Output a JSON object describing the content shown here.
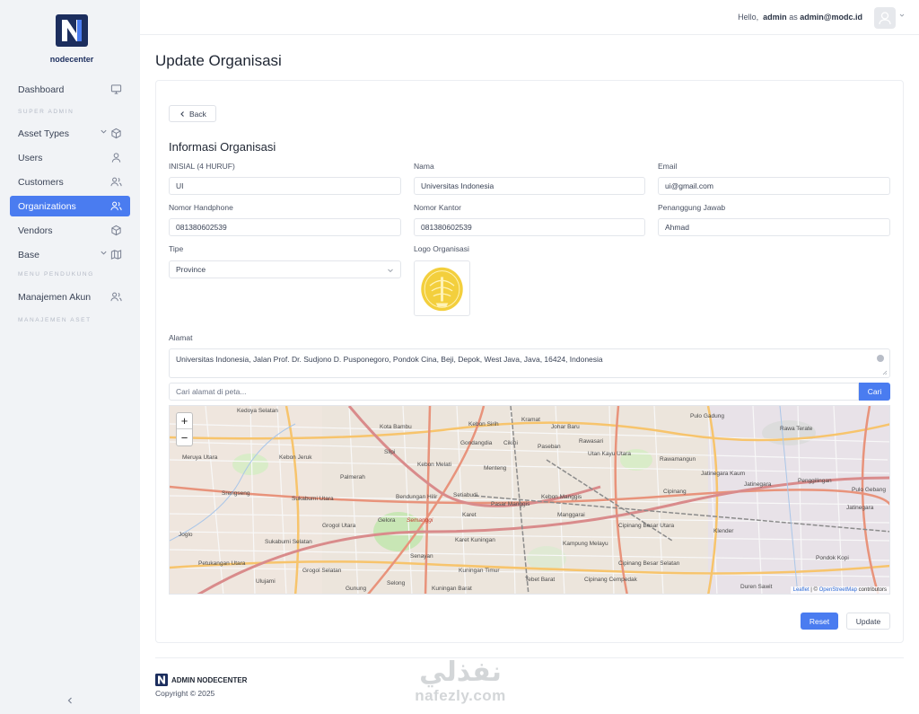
{
  "brand": {
    "name": "nodecenter",
    "footer_name": "ADMIN NODECENTER",
    "copyright": "Copyright © 2025"
  },
  "sidebar": {
    "items": [
      {
        "label": "Dashboard",
        "icon": "monitor-icon"
      },
      {
        "label": "Asset Types",
        "icon": "box-icon"
      },
      {
        "label": "Users",
        "icon": "user-icon"
      },
      {
        "label": "Customers",
        "icon": "users-icon"
      },
      {
        "label": "Organizations",
        "icon": "users-icon",
        "active": true
      },
      {
        "label": "Vendors",
        "icon": "box-icon"
      },
      {
        "label": "Base",
        "icon": "map-icon"
      },
      {
        "label": "Manajemen Akun",
        "icon": "users-icon"
      }
    ],
    "sections": [
      "SUPER ADMIN",
      "MENU PENDUKUNG",
      "MANAJEMEN ASET DINAMIS"
    ]
  },
  "header": {
    "hello": "Hello,",
    "user": "admin",
    "as": "as",
    "email": "admin@modc.id"
  },
  "page": {
    "title": "Update Organisasi",
    "back": "Back",
    "section": "Informasi Organisasi"
  },
  "form": {
    "inisial": {
      "label": "INISIAL (4 HURUF)",
      "value": "UI"
    },
    "nama": {
      "label": "Nama",
      "value": "Universitas Indonesia"
    },
    "email": {
      "label": "Email",
      "value": "ui@gmail.com"
    },
    "hp": {
      "label": "Nomor Handphone",
      "value": "081380602539"
    },
    "kantor": {
      "label": "Nomor Kantor",
      "value": "081380602539"
    },
    "pj": {
      "label": "Penanggung Jawab",
      "value": "Ahmad"
    },
    "tipe": {
      "label": "Tipe",
      "value": "Province"
    },
    "logo": {
      "label": "Logo Organisasi"
    },
    "alamat": {
      "label": "Alamat",
      "value": "Universitas Indonesia, Jalan Prof. Dr. Sudjono D. Pusponegoro, Pondok Cina, Beji, Depok, West Java, Java, 16424, Indonesia"
    }
  },
  "map": {
    "search_placeholder": "Cari alamat di peta...",
    "search_button": "Cari",
    "zoom_in": "+",
    "zoom_out": "−",
    "attr_leaflet": "Leaflet",
    "attr_sep": " | © ",
    "attr_osm": "OpenStreetMap",
    "attr_contrib": " contributors",
    "labels": [
      "Kedoya Selatan",
      "Kota Bambu",
      "Kebon Sirih",
      "Kramat",
      "Johar Baru",
      "Pulo Gadung",
      "Rawa Terate",
      "Meruya Utara",
      "Kebon Jeruk",
      "Slipi",
      "Gondangdia",
      "Cikini",
      "Paseban",
      "Rawasari",
      "Kebon Melati",
      "Menteng",
      "Utan Kayu Utara",
      "Rawamangun",
      "Jatinegara Kaum",
      "Srengseng",
      "Palmerah",
      "Bendungan Hilir",
      "Setiabudi",
      "Kebon Manggis",
      "Cipinang",
      "Jatinegara",
      "Penggilingan",
      "Pulo Gebang",
      "Sukabumi Utara",
      "Grogol Utara",
      "Gelora",
      "Semanggi",
      "Karet",
      "Pasar Manggis",
      "Manggarai",
      "Cipinang Besar Utara",
      "Klender",
      "Jatinegara",
      "Joglo",
      "Sukabumi Selatan",
      "Senayan",
      "Karet Kuningan",
      "Kampung Melayu",
      "Petukangan Utara",
      "Ulujami",
      "Grogol Selatan",
      "Kuningan Timur",
      "Cipinang Besar Selatan",
      "Pondok Kopi",
      "Gunung",
      "Selong",
      "Kuningan Barat",
      "Tebet Barat",
      "Cipinang Cempedak",
      "Duren Sawit"
    ]
  },
  "actions": {
    "reset": "Reset",
    "update": "Update"
  },
  "watermark": {
    "ar": "نفذلي",
    "en": "nafezly.com"
  },
  "colors": {
    "primary": "#4a7cf0",
    "brand_dark": "#1c2e5e",
    "sidebar_bg": "#f1f3f6"
  }
}
